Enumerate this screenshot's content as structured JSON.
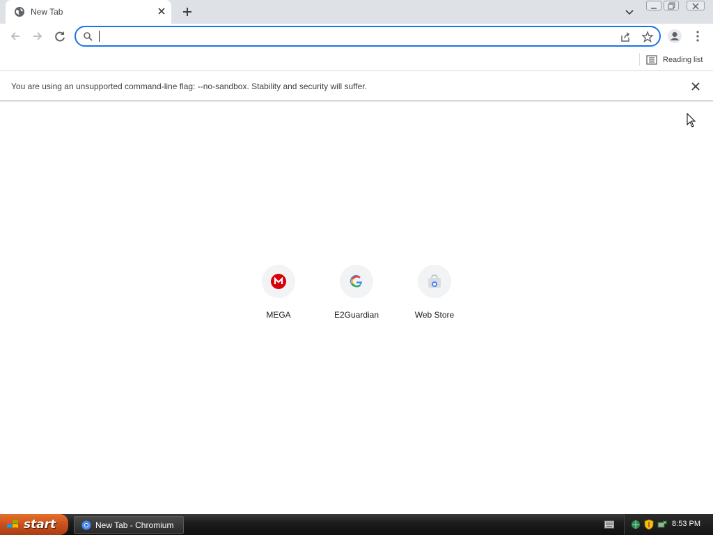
{
  "tab": {
    "title": "New Tab"
  },
  "omnibox": {
    "value": "",
    "placeholder": ""
  },
  "bookmarks": {
    "reading_list": "Reading list"
  },
  "infobar": {
    "message": "You are using an unsupported command-line flag: --no-sandbox. Stability and security will suffer."
  },
  "shortcuts": [
    {
      "label": "MEGA",
      "icon": "mega-icon"
    },
    {
      "label": "E2Guardian",
      "icon": "google-icon"
    },
    {
      "label": "Web Store",
      "icon": "web-store-icon"
    }
  ],
  "taskbar": {
    "start_label": "start",
    "task_label": "New Tab - Chromium",
    "clock": "8:53 PM"
  },
  "colors": {
    "accent": "#1a73e8",
    "mega_red": "#d90007",
    "tab_strip": "#dee1e6"
  }
}
